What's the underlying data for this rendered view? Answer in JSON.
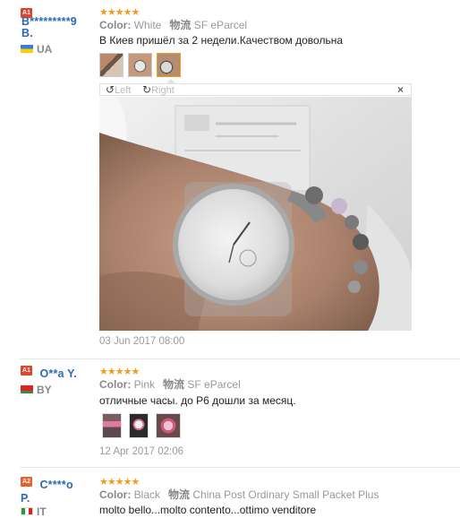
{
  "reviews": [
    {
      "level": "A1",
      "name": "B*********9\nB.",
      "name_line1": "B*********9",
      "name_line2": "B.",
      "country": "UA",
      "stars": "★★★★★",
      "color_label": "Color:",
      "color_value": "White",
      "ship_label": "物流",
      "ship_value": "SF eParcel",
      "text": "В Киев пришёл за 2 недели.Качеством довольна",
      "date": "03 Jun 2017 08:00",
      "viewer": {
        "rotate_left": "Left",
        "rotate_right": "Right",
        "close": "×"
      }
    },
    {
      "level": "A1",
      "name": "O**a Y.",
      "country": "BY",
      "stars": "★★★★★",
      "color_label": "Color:",
      "color_value": "Pink",
      "ship_label": "物流",
      "ship_value": "SF eParcel",
      "text": "отличные часы. до Р6 дошли за месяц.",
      "date": "12 Apr 2017 02:06"
    },
    {
      "level": "A2",
      "name": "C****o\nP.",
      "name_line1": "C****o",
      "name_line2": "P.",
      "country": "IT",
      "stars": "★★★★★",
      "color_label": "Color:",
      "color_value": "Black",
      "ship_label": "物流",
      "ship_value": "China Post Ordinary Small Packet Plus",
      "text": "molto bello...molto contento...ottimo venditore"
    }
  ],
  "colors": {
    "link": "#2a6bb3",
    "star": "#f29c1f",
    "level_badge": "#e0442d",
    "muted": "#999999"
  }
}
